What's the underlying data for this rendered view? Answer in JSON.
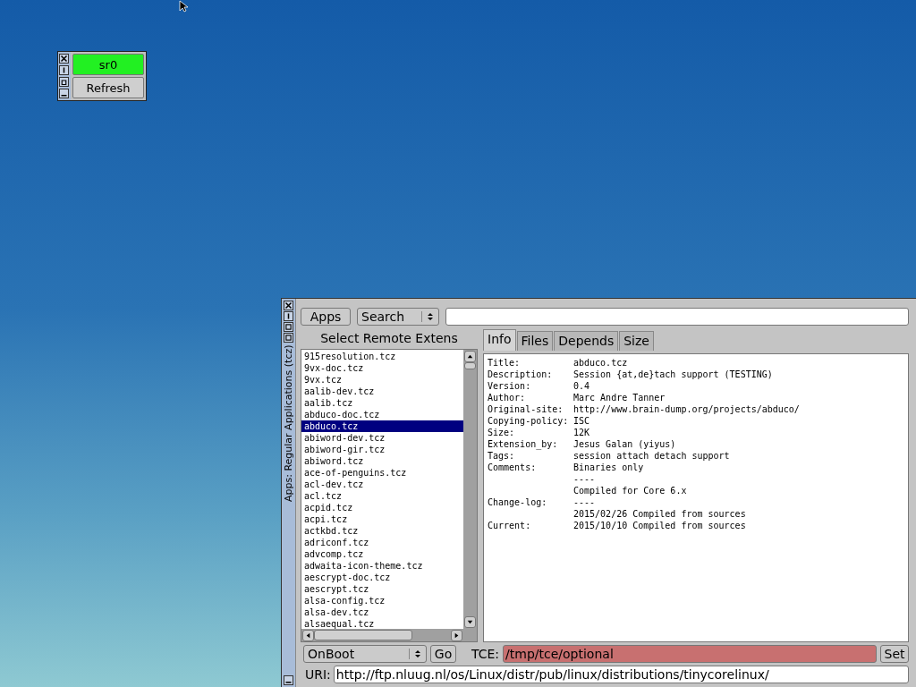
{
  "mount_panel": {
    "buttons": [
      {
        "label": "sr0",
        "mounted": true
      },
      {
        "label": "Refresh",
        "mounted": false
      }
    ]
  },
  "window": {
    "title": "Apps: Regular Applications (tcz)",
    "toolbar": {
      "apps_button": "Apps",
      "mode_select": "Search"
    },
    "list_heading": "Select Remote Extens",
    "extensions": [
      {
        "name": "915resolution.tcz",
        "selected": false
      },
      {
        "name": "9vx-doc.tcz",
        "selected": false
      },
      {
        "name": "9vx.tcz",
        "selected": false
      },
      {
        "name": "aalib-dev.tcz",
        "selected": false
      },
      {
        "name": "aalib.tcz",
        "selected": false
      },
      {
        "name": "abduco-doc.tcz",
        "selected": false
      },
      {
        "name": "abduco.tcz",
        "selected": true
      },
      {
        "name": "abiword-dev.tcz",
        "selected": false
      },
      {
        "name": "abiword-gir.tcz",
        "selected": false
      },
      {
        "name": "abiword.tcz",
        "selected": false
      },
      {
        "name": "ace-of-penguins.tcz",
        "selected": false
      },
      {
        "name": "acl-dev.tcz",
        "selected": false
      },
      {
        "name": "acl.tcz",
        "selected": false
      },
      {
        "name": "acpid.tcz",
        "selected": false
      },
      {
        "name": "acpi.tcz",
        "selected": false
      },
      {
        "name": "actkbd.tcz",
        "selected": false
      },
      {
        "name": "adriconf.tcz",
        "selected": false
      },
      {
        "name": "advcomp.tcz",
        "selected": false
      },
      {
        "name": "adwaita-icon-theme.tcz",
        "selected": false
      },
      {
        "name": "aescrypt-doc.tcz",
        "selected": false
      },
      {
        "name": "aescrypt.tcz",
        "selected": false
      },
      {
        "name": "alsa-config.tcz",
        "selected": false
      },
      {
        "name": "alsa-dev.tcz",
        "selected": false
      },
      {
        "name": "alsaequal.tcz",
        "selected": false
      }
    ],
    "tabs": [
      {
        "label": "Info",
        "selected": true
      },
      {
        "label": "Files",
        "selected": false
      },
      {
        "label": "Depends",
        "selected": false
      },
      {
        "label": "Size",
        "selected": false
      }
    ],
    "info": [
      {
        "label": "Title:",
        "value": "abduco.tcz"
      },
      {
        "label": "Description:",
        "value": "Session {at,de}tach support (TESTING)"
      },
      {
        "label": "Version:",
        "value": "0.4"
      },
      {
        "label": "Author:",
        "value": "Marc Andre Tanner"
      },
      {
        "label": "Original-site:",
        "value": "http://www.brain-dump.org/projects/abduco/"
      },
      {
        "label": "Copying-policy:",
        "value": "ISC"
      },
      {
        "label": "Size:",
        "value": "12K"
      },
      {
        "label": "Extension_by:",
        "value": "Jesus Galan (yiyus)"
      },
      {
        "label": "Tags:",
        "value": "session attach detach support"
      },
      {
        "label": "Comments:",
        "value": "Binaries only"
      },
      {
        "value": "----"
      },
      {
        "value": "Compiled for Core 6.x"
      },
      {
        "label": "Change-log:",
        "value": "----"
      },
      {
        "value": "2015/02/26 Compiled from sources"
      },
      {
        "label": "Current:",
        "value": "2015/10/10 Compiled from sources"
      }
    ],
    "install_mode": "OnBoot",
    "go_button": "Go",
    "tce_label": "TCE:",
    "tce_field": {
      "value": "/tmp/tce/optional",
      "invalid": true
    },
    "set_button": "Set",
    "uri_label": "URI:",
    "uri_field": {
      "value": "http://ftp.nluug.nl/os/Linux/distr/pub/linux/distributions/tinycorelinux/"
    }
  }
}
